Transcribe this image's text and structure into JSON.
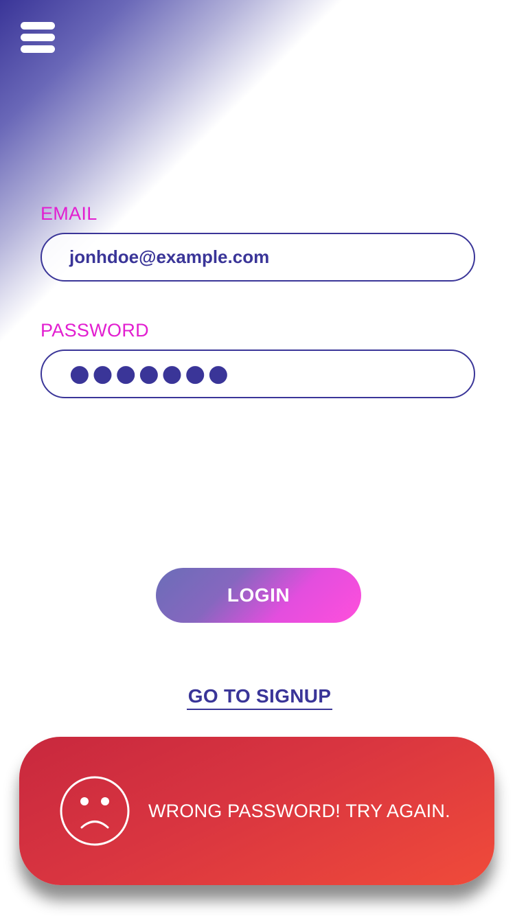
{
  "menu": {
    "icon": "hamburger-menu-icon"
  },
  "form": {
    "email_label": "EMAIL",
    "email_value": "jonhdoe@example.com",
    "password_label": "PASSWORD",
    "password_value": "●●●●●●●"
  },
  "actions": {
    "login_label": "LOGIN",
    "signup_label": "GO TO SIGNUP"
  },
  "toast": {
    "icon": "sad-face-icon",
    "message": "WRONG PASSWORD! TRY AGAIN."
  },
  "colors": {
    "brand_primary": "#3a3598",
    "label_accent": "#e21ed0",
    "button_gradient_start": "#6b6db8",
    "button_gradient_end": "#ff4fdc",
    "error_start": "#c8283e",
    "error_end": "#f04b3a"
  }
}
